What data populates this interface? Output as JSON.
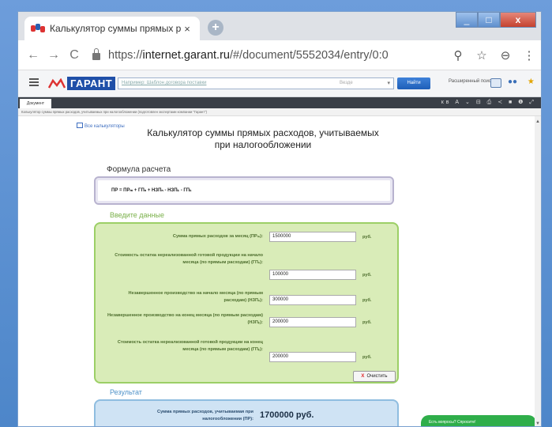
{
  "browser": {
    "tab_title": "Калькулятор суммы прямых ра",
    "tab_close": "×",
    "new_tab": "+",
    "url_prefix": "https://",
    "url_host": "internet.garant.ru",
    "url_path": "/#/document/5552034/entry/0:0",
    "back": "←",
    "forward": "→",
    "reload": "C",
    "zoom_icon": "⚲",
    "star": "☆",
    "account": "⊖",
    "menu": "⋮",
    "win_min": "_",
    "win_max": "□",
    "win_close": "x"
  },
  "garant": {
    "logo": "ГАРАНТ",
    "search_placeholder": "Например: Шаблон договора поставки",
    "search_mid": "Везде",
    "search_dd": "▾",
    "find_button": "Найти",
    "ext_search": "Расширенный поиск"
  },
  "doc": {
    "tab": "Документ",
    "breadcrumb": "Калькулятор суммы прямых расходов, учитываемых при налогообложении (подготовлен экспертами компании \"Гарант\")",
    "toolbar_icons": "кв А ⌄ ⊟ ⎙ ≺ ■ ❶ ⤢"
  },
  "page": {
    "all_calculators": "Все калькуляторы",
    "title": "Калькулятор суммы прямых расходов, учитываемых при налогообложении",
    "formula_heading": "Формула расчета",
    "formula": "ПР = ПРₘ + ГПₙ + НЗПₙ - НЗПₖ - ГПₖ",
    "input_heading": "Введите данные",
    "fields": [
      {
        "label": "Сумма прямых расходов за месяц (ПРₘ):",
        "value": "1500000",
        "unit": "руб."
      },
      {
        "label": "Стоимость остатка нереализованной готовой продукции на начало месяца (по прямым расходам) (ГПₙ):",
        "value": "100000",
        "unit": "руб."
      },
      {
        "label": "Незавершенное производство на начало месяца (по прямым расходам) (НЗПₙ):",
        "value": "300000",
        "unit": "руб."
      },
      {
        "label": "Незавершенное производство на конец месяца (по прямым расходам) (НЗПₖ):",
        "value": "200000",
        "unit": "руб."
      },
      {
        "label": "Стоимость остатка нереализованной готовой продукции на конец месяца (по прямым расходам) (ГПₖ):",
        "value": "200000",
        "unit": "руб."
      }
    ],
    "clear_icon": "X",
    "clear_button": "Очистить",
    "result_heading": "Результат",
    "result_label": "Сумма прямых расходов, учитываемая при налогообложении (ПР):",
    "result_value": "1700000 руб.",
    "chat": "Есть вопросы? Спросите!"
  }
}
